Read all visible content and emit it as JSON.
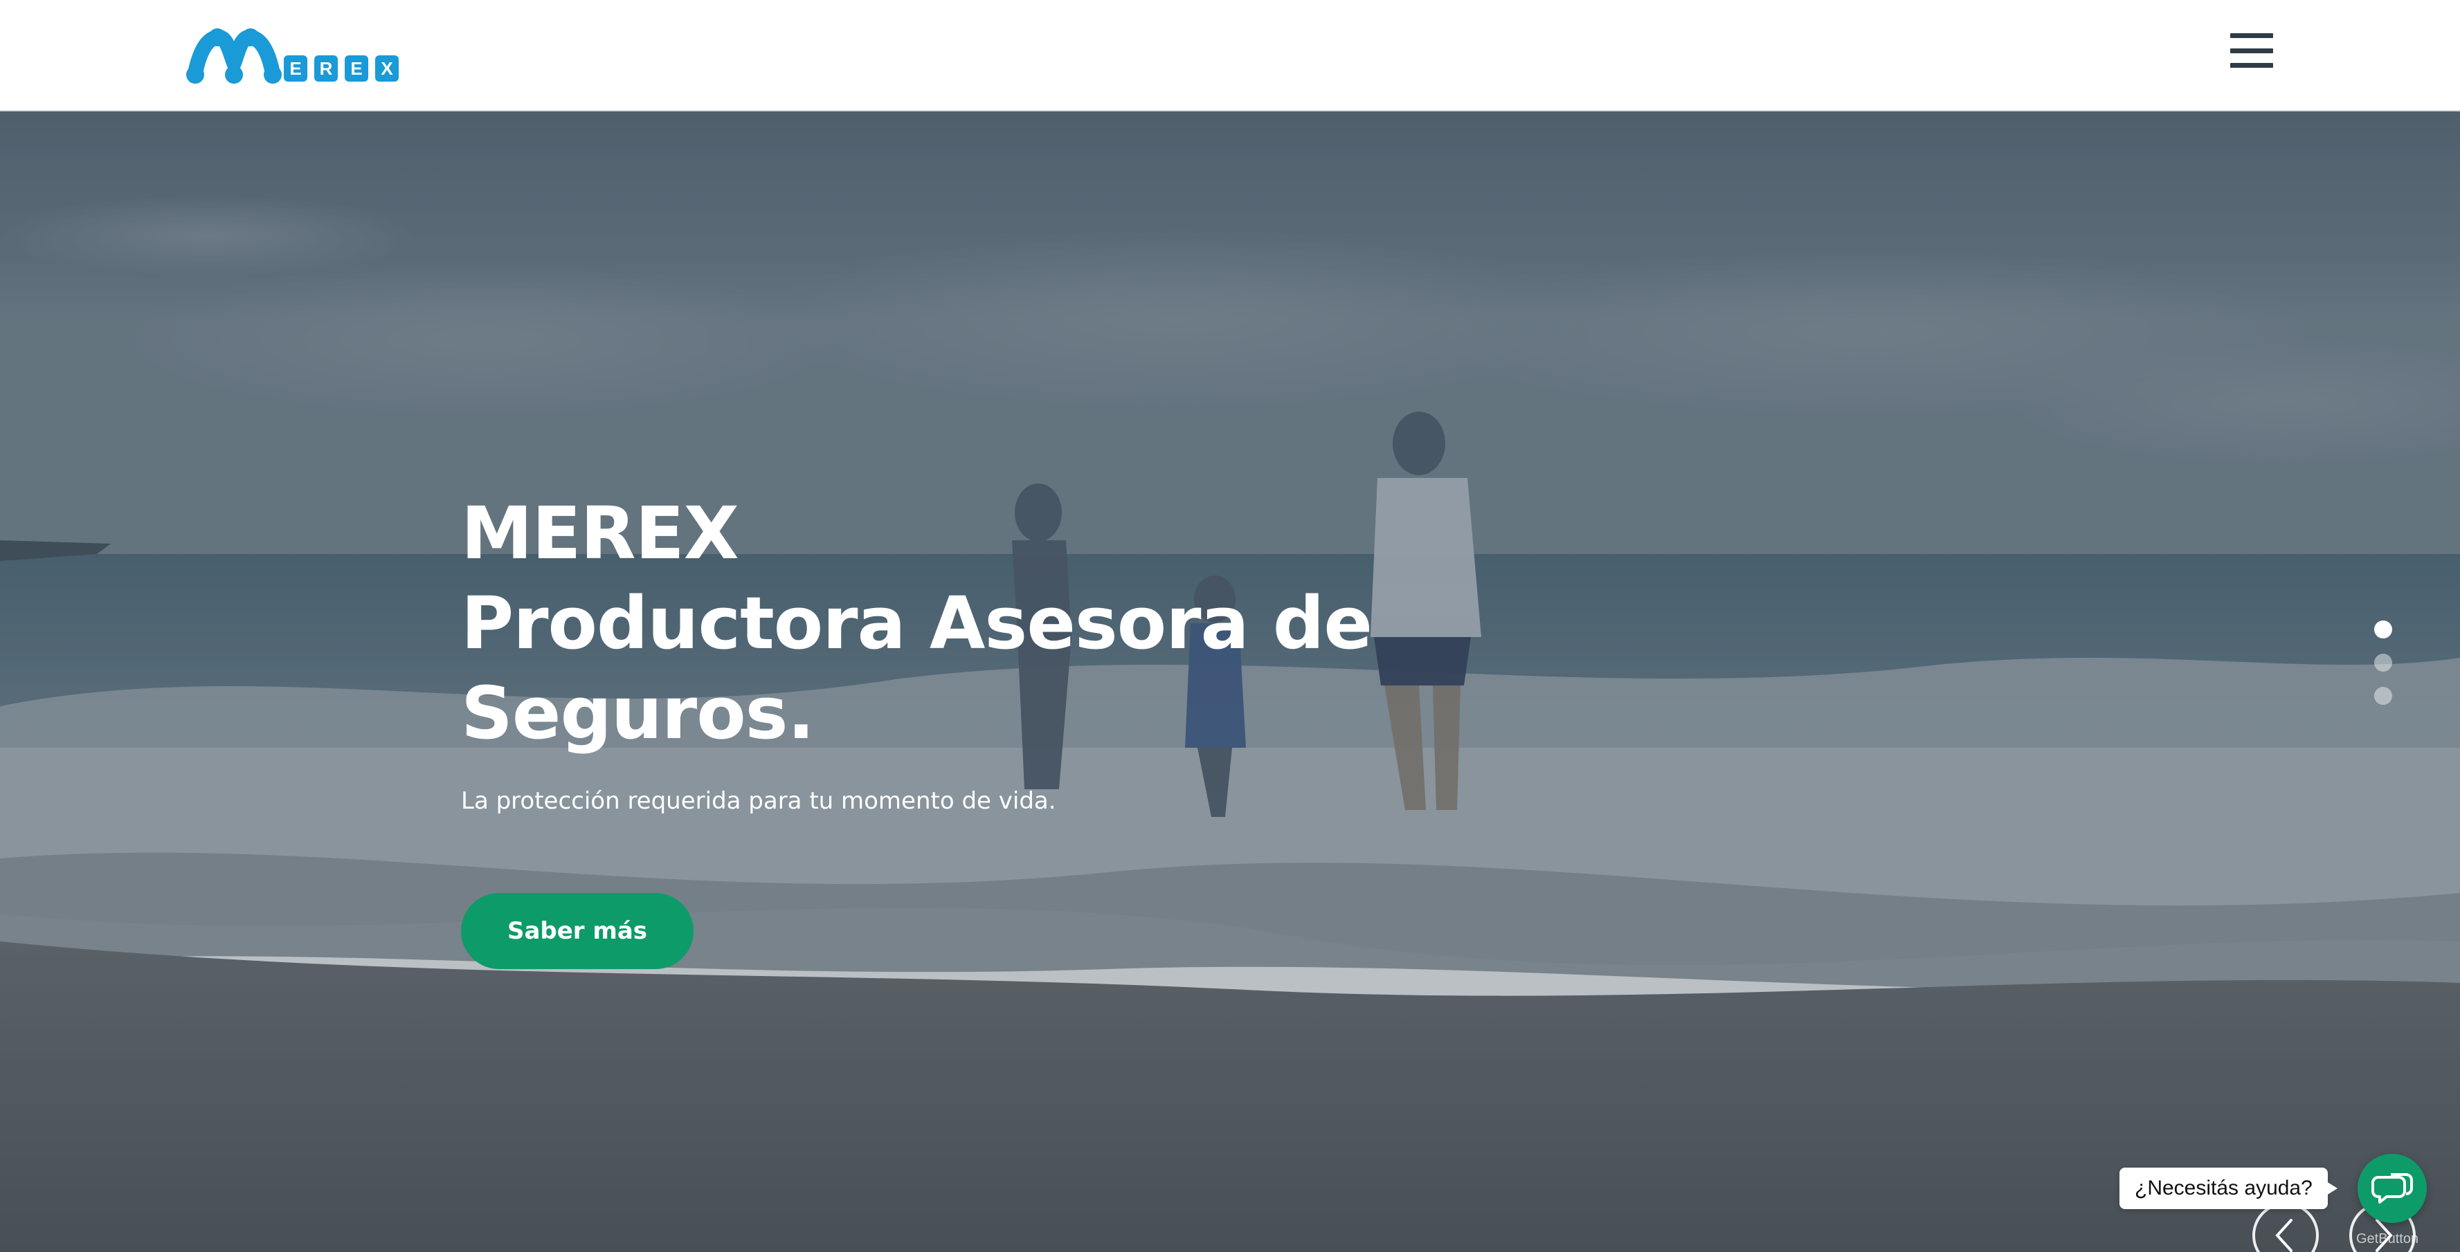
{
  "header": {
    "logo_text": "MEREX",
    "menu_icon": "hamburger-menu-icon"
  },
  "hero": {
    "title_line1": "MEREX",
    "title_line2": "Productora Asesora de",
    "title_line3": "Seguros.",
    "subtitle": "La protección requerida para tu momento de vida.",
    "cta_label": "Saber más"
  },
  "slider": {
    "active_slide": 1,
    "slide_count": 3,
    "prev_icon": "chevron-left-icon",
    "next_icon": "chevron-right-icon"
  },
  "chat": {
    "prompt": "¿Necesitás ayuda?",
    "icon": "chat-icon",
    "brand": "GetButton"
  },
  "colors": {
    "brand_blue": "#1a9ad6",
    "accent_green": "#0e9b6a",
    "overlay": "#3c4a55"
  }
}
